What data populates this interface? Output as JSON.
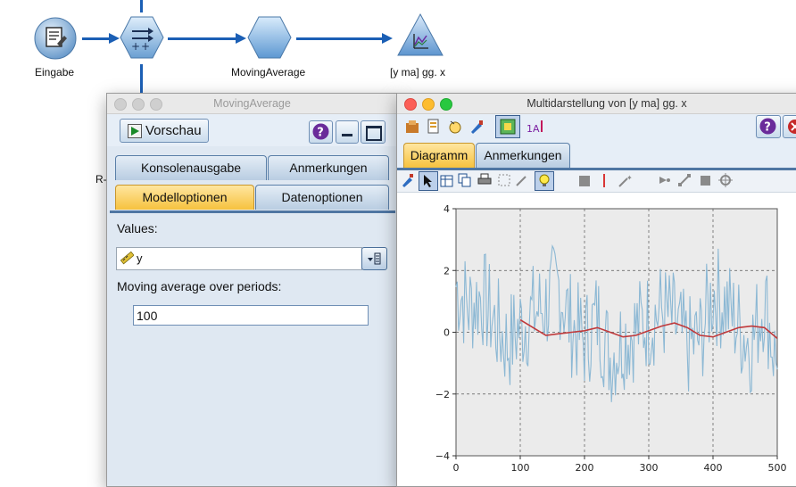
{
  "canvas": {
    "nodes": [
      {
        "id": "eingabe",
        "label": "Eingabe"
      },
      {
        "id": "filter",
        "label": ""
      },
      {
        "id": "moving-average",
        "label": "MovingAverage"
      },
      {
        "id": "plot",
        "label": "[y ma] gg. x"
      }
    ],
    "partial_label": "R-"
  },
  "dialog": {
    "title": "MovingAverage",
    "preview_label": "Vorschau",
    "tabs_row1": [
      "Konsolenausgabe",
      "Anmerkungen"
    ],
    "tabs_row2": [
      "Modelloptionen",
      "Datenoptionen"
    ],
    "values_label": "Values:",
    "values_field": "y",
    "periods_label": "Moving average over periods:",
    "periods_value": "100"
  },
  "chart_window": {
    "title": "Multidarstellung von [y ma] gg. x",
    "tabs": [
      "Diagramm",
      "Anmerkungen"
    ]
  },
  "colors": {
    "flow_blue": "#1b5fb5",
    "raw_series": "#8cb8d4",
    "ma_series": "#c0393b",
    "active_tab": "#f6c23e"
  },
  "chart_data": {
    "type": "line",
    "title": "",
    "xlabel": "",
    "ylabel": "",
    "x_ticks": [
      "0",
      "100",
      "200",
      "300",
      "400",
      "500"
    ],
    "y_ticks": [
      "4",
      "2",
      "0",
      "−2",
      "−4"
    ],
    "xlim": [
      0,
      500
    ],
    "ylim": [
      -4,
      4
    ],
    "grid": true,
    "series": [
      {
        "name": "",
        "color": "#8cb8d4",
        "x": [
          0,
          20,
          40,
          60,
          80,
          100,
          120,
          140,
          160,
          180,
          200,
          220,
          240,
          260,
          280,
          300,
          320,
          340,
          360,
          380,
          400,
          420,
          440,
          460,
          480,
          500
        ],
        "values": [
          1.5,
          0.8,
          1.2,
          0.3,
          -0.4,
          0.2,
          0.6,
          0.9,
          1.5,
          0.2,
          -0.3,
          0.5,
          -0.8,
          -0.2,
          0.1,
          0.4,
          0.7,
          0.3,
          -0.5,
          -0.2,
          1.3,
          0.9,
          0.2,
          -0.4,
          1.1,
          -1.2
        ]
      },
      {
        "name": "",
        "color": "#c0393b",
        "x": [
          100,
          120,
          140,
          160,
          180,
          200,
          220,
          240,
          260,
          280,
          300,
          320,
          340,
          360,
          380,
          400,
          420,
          440,
          460,
          480,
          500
        ],
        "values": [
          0.4,
          0.15,
          -0.1,
          -0.05,
          0.0,
          0.05,
          0.15,
          0.0,
          -0.15,
          -0.1,
          0.05,
          0.2,
          0.3,
          0.15,
          -0.1,
          -0.15,
          0.0,
          0.15,
          0.2,
          0.15,
          -0.2
        ]
      }
    ]
  }
}
